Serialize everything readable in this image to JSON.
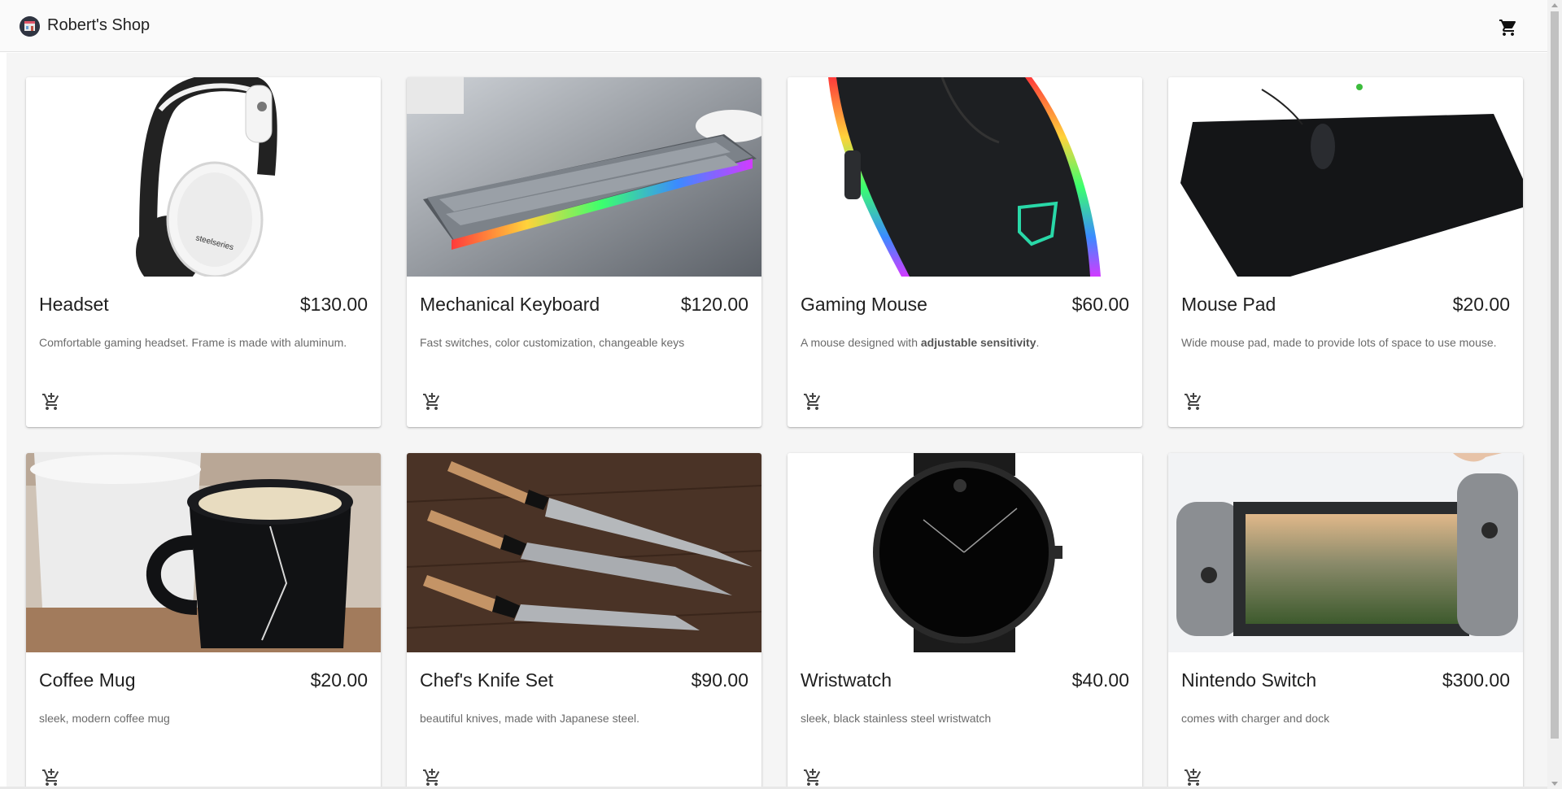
{
  "header": {
    "brand": "Robert's Shop",
    "logo_icon": "shop-logo-icon",
    "cart_icon": "shopping-cart-icon"
  },
  "products": [
    {
      "name": "Headset",
      "price": "$130.00",
      "description": "Comfortable gaming headset. Frame is made with aluminum.",
      "image": "headset-image"
    },
    {
      "name": "Mechanical Keyboard",
      "price": "$120.00",
      "description": "Fast switches, color customization, changeable keys",
      "image": "keyboard-image"
    },
    {
      "name": "Gaming Mouse",
      "price": "$60.00",
      "description_pre": "A mouse designed with ",
      "description_bold": "adjustable sensitivity",
      "description_post": ".",
      "image": "mouse-image"
    },
    {
      "name": "Mouse Pad",
      "price": "$20.00",
      "description": "Wide mouse pad, made to provide lots of space to use mouse.",
      "image": "mouse-pad-image"
    },
    {
      "name": "Coffee Mug",
      "price": "$20.00",
      "description": "sleek, modern coffee mug",
      "image": "coffee-mug-image"
    },
    {
      "name": "Chef's Knife Set",
      "price": "$90.00",
      "description": "beautiful knives, made with Japanese steel.",
      "image": "knife-set-image"
    },
    {
      "name": "Wristwatch",
      "price": "$40.00",
      "description": "sleek, black stainless steel wristwatch",
      "image": "wristwatch-image"
    },
    {
      "name": "Nintendo Switch",
      "price": "$300.00",
      "description": "comes with charger and dock",
      "image": "nintendo-switch-image"
    }
  ],
  "add_to_cart_icon": "add-shopping-cart-icon",
  "colors": {
    "appbar": "#fafafa",
    "background": "#f5f5f5",
    "card": "#ffffff",
    "text": "#1f1f1f",
    "muted": "#6b6b6b"
  }
}
